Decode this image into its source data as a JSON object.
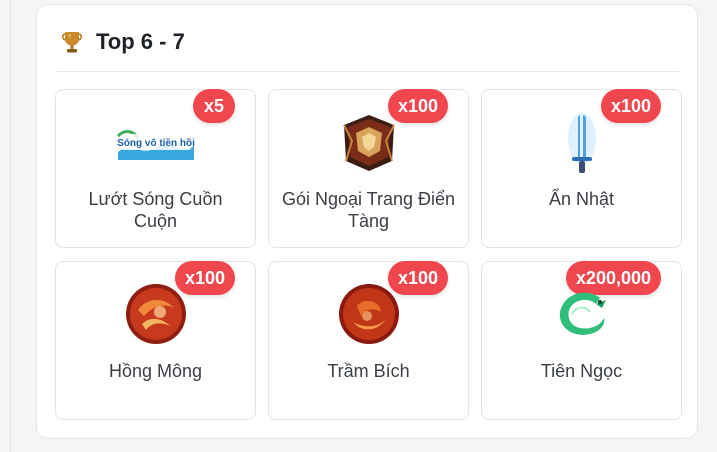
{
  "section": {
    "icon": "trophy-icon",
    "title": "Top 6 - 7"
  },
  "items": [
    {
      "name": "Lướt Sóng Cuồn Cuộn",
      "quantity": "x5",
      "image": "surf-banner-icon",
      "image_text": "Sóng vô tiền hồi"
    },
    {
      "name": "Gói Ngoại Trang Điển Tàng",
      "quantity": "x100",
      "image": "armor-box-icon"
    },
    {
      "name": "Ẩn Nhật",
      "quantity": "x100",
      "image": "sword-icon"
    },
    {
      "name": "Hồng Mông",
      "quantity": "x100",
      "image": "red-orb-icon"
    },
    {
      "name": "Trầm Bích",
      "quantity": "x100",
      "image": "red-orb-icon"
    },
    {
      "name": "Tiên Ngọc",
      "quantity": "x200,000",
      "image": "jade-dragon-icon"
    }
  ],
  "colors": {
    "badge": "#f0474f",
    "trophy": "#c98a2e"
  }
}
